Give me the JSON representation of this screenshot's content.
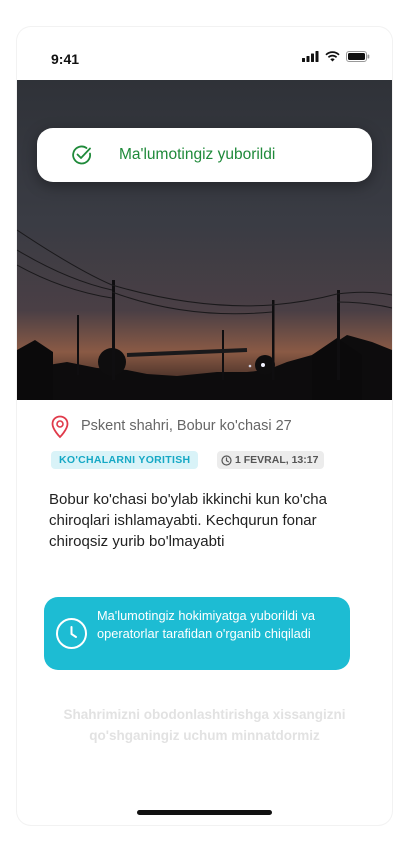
{
  "status_bar": {
    "time": "9:41"
  },
  "toast": {
    "message": "Ma'lumotingiz yuborildi"
  },
  "report": {
    "address": "Pskent shahri, Bobur ko'chasi 27",
    "category": "KO'CHALARNI YORITISH",
    "date": "1 FEVRAL, 13:17",
    "description": "Bobur ko'chasi bo'ylab ikkinchi kun ko'cha chiroqlari ishlamayabti. Kechqurun fonar chiroqsiz yurib bo'lmayabti"
  },
  "info_banner": {
    "text": "Ma'lumotingiz hokimiyatga yuborildi va operatorlar tarafidan o'rganib chiqiladi"
  },
  "thanks": {
    "text": "Shahrimizni obodonlashtirishga xissangizni qo'shganingiz uchum minnatdormiz"
  },
  "colors": {
    "accent": "#1dbcd3",
    "success": "#1f8a3a",
    "pin": "#e03a4a",
    "tag_bg": "#d9f3f8"
  },
  "icons": [
    "signal-icon",
    "wifi-icon",
    "battery-icon",
    "check-circle-icon",
    "location-pin-icon",
    "clock-icon"
  ]
}
